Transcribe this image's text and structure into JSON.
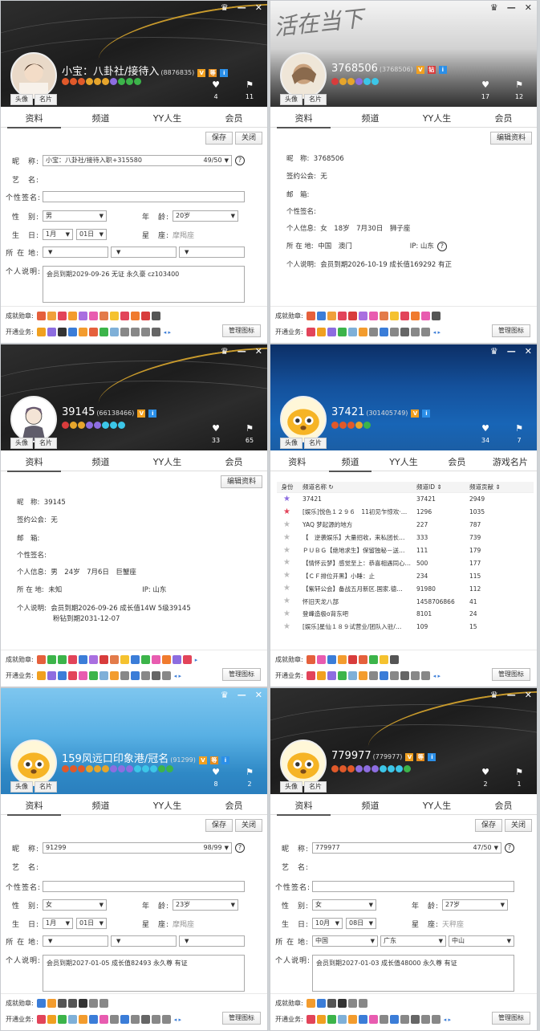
{
  "common": {
    "tabs": [
      "资料",
      "频道",
      "YY人生",
      "会员"
    ],
    "tabs_channel_panel": [
      "资料",
      "频道",
      "YY人生",
      "会员",
      "游戏名片"
    ],
    "avatar_btn": "头像",
    "card_btn": "名片",
    "save_btn": "保存",
    "close_btn": "关闭",
    "edit_btn": "编辑资料",
    "manage_btn": "管理图标",
    "achievements_label": "成就勋章:",
    "services_label": "开通业务:",
    "win_icons": [
      "♛",
      "—",
      "✕"
    ]
  },
  "p1": {
    "name": "小宝：八卦社/接待入",
    "uid": "(8876835)",
    "likes": "4",
    "fans": "11",
    "labels": {
      "nick": "昵　称:",
      "art": "艺　名:",
      "sign": "个性签名:",
      "gender": "性　别:",
      "age": "年　龄:",
      "birth": "生　日:",
      "zodiac": "星　座:",
      "loc": "所 在 地:",
      "desc": "个人说明:"
    },
    "nick": "小宝：八卦社/接待入职+315580",
    "nick_count": "49/50",
    "gender": "男",
    "age": "20岁",
    "month": "1月",
    "day": "01日",
    "zodiac": "摩羯座",
    "desc": "会员到期2029-09-26 无证 永久豪 cz103400"
  },
  "p2": {
    "name": "3768506",
    "uid": "(3768506)",
    "likes": "17",
    "fans": "12",
    "signature": "活在当下",
    "nick_label": "昵　称:",
    "nick": "3768506",
    "guild_label": "签约公会:",
    "guild": "无",
    "mail_label": "邮　箱:",
    "sign_label": "个性签名:",
    "info_label": "个人信息:",
    "info": "女　18岁　7月30日　狮子座",
    "loc_label": "所 在 地:",
    "loc": "中国　澳门",
    "ip_label": "IP: 山东",
    "desc_label": "个人说明:",
    "desc": "会员到期2026-10-19 成长值169292 有正"
  },
  "p3": {
    "name": "39145",
    "uid": "(66138466)",
    "likes": "33",
    "fans": "65",
    "nick_label": "昵　称:",
    "nick": "39145",
    "guild_label": "签约公会:",
    "guild": "无",
    "mail_label": "邮　箱:",
    "sign_label": "个性签名:",
    "info_label": "个人信息:",
    "info": "男　24岁　7月6日　巨蟹座",
    "loc_label": "所 在 地:",
    "loc": "未知",
    "ip_label": "IP: 山东",
    "desc_label": "个人说明:",
    "desc1": "会员到期2026-09-26 成长值14W 5级39145",
    "desc2": "粉钻到期2031-12-07"
  },
  "p4": {
    "name": "37421",
    "uid": "(301405749)",
    "likes": "34",
    "fans": "7",
    "head": {
      "identity": "身份",
      "channel": "频道名称",
      "id": "频道ID",
      "contrib": "频道贡献"
    },
    "rows": [
      {
        "name": "37421",
        "id": "37421",
        "c": "2949"
      },
      {
        "name": "[娱乐]悦色１２９６　11初见乍惊欢·…",
        "id": "1296",
        "c": "1035"
      },
      {
        "name": "YAQ 梦起源的地方",
        "id": "227",
        "c": "787"
      },
      {
        "name": "【　逆袭娱乐】大量招收，来私团长…",
        "id": "333",
        "c": "739"
      },
      {
        "name": "ＰＵＢＧ【绝地求生】保留独秘－送…",
        "id": "111",
        "c": "179"
      },
      {
        "name": "【情怀云梦】感觉至上：恭喜相遇同心…",
        "id": "500",
        "c": "177"
      },
      {
        "name": "【ＣＦ排位开黑】小睡：止",
        "id": "234",
        "c": "115"
      },
      {
        "name": "【紫轩公会】备战五月新区.国家.德…",
        "id": "91980",
        "c": "112"
      },
      {
        "name": "怀旧天龙八部",
        "id": "1458706866",
        "c": "41"
      },
      {
        "name": "登峰造极o背东吧",
        "id": "8101",
        "c": "24"
      },
      {
        "name": "[娱乐]星仙１８９试营业/团队入驻/…",
        "id": "109",
        "c": "15"
      }
    ]
  },
  "p5": {
    "name": "159风远口印象港/冠名",
    "uid": "(91299)",
    "likes": "8",
    "fans": "2",
    "nick": "91299",
    "nick_count": "98/99",
    "gender": "女",
    "age": "23岁",
    "month": "1月",
    "day": "01日",
    "zodiac": "摩羯座",
    "desc": "会员到期2027-01-05 成长值82493 永久尊 有证"
  },
  "p6": {
    "name": "779977",
    "uid": "(779977)",
    "likes": "2",
    "fans": "1",
    "nick": "779977",
    "nick_count": "47/50",
    "gender": "女",
    "age": "27岁",
    "month": "10月",
    "day": "08日",
    "zodiac": "天秤座",
    "country": "中国",
    "province": "广东",
    "city": "中山",
    "desc": "会员到期2027-01-03 成长值48000 永久尊 有证"
  }
}
